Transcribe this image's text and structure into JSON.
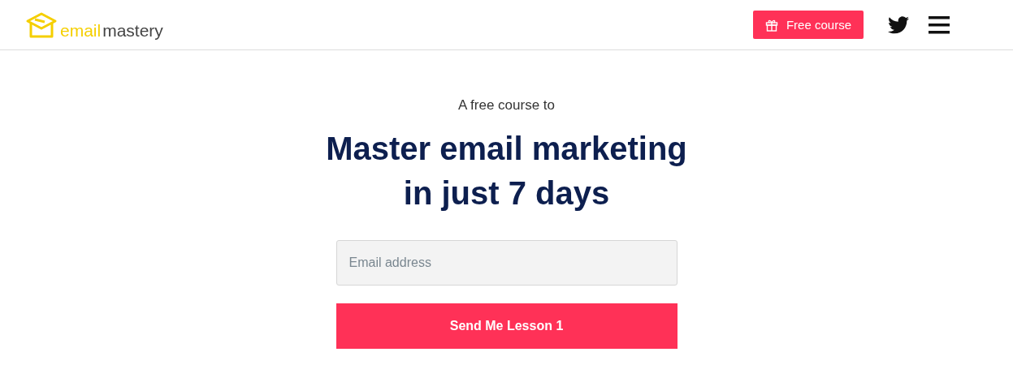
{
  "header": {
    "logo": {
      "part_1": "email",
      "part_2": "mastery"
    },
    "free_course_button": "Free course"
  },
  "hero": {
    "kicker": "A free course to",
    "headline": [
      "Master email marketing",
      "in just 7 days"
    ],
    "email_field": {
      "placeholder": "Email address"
    },
    "submit_button": "Send Me Lesson 1"
  }
}
